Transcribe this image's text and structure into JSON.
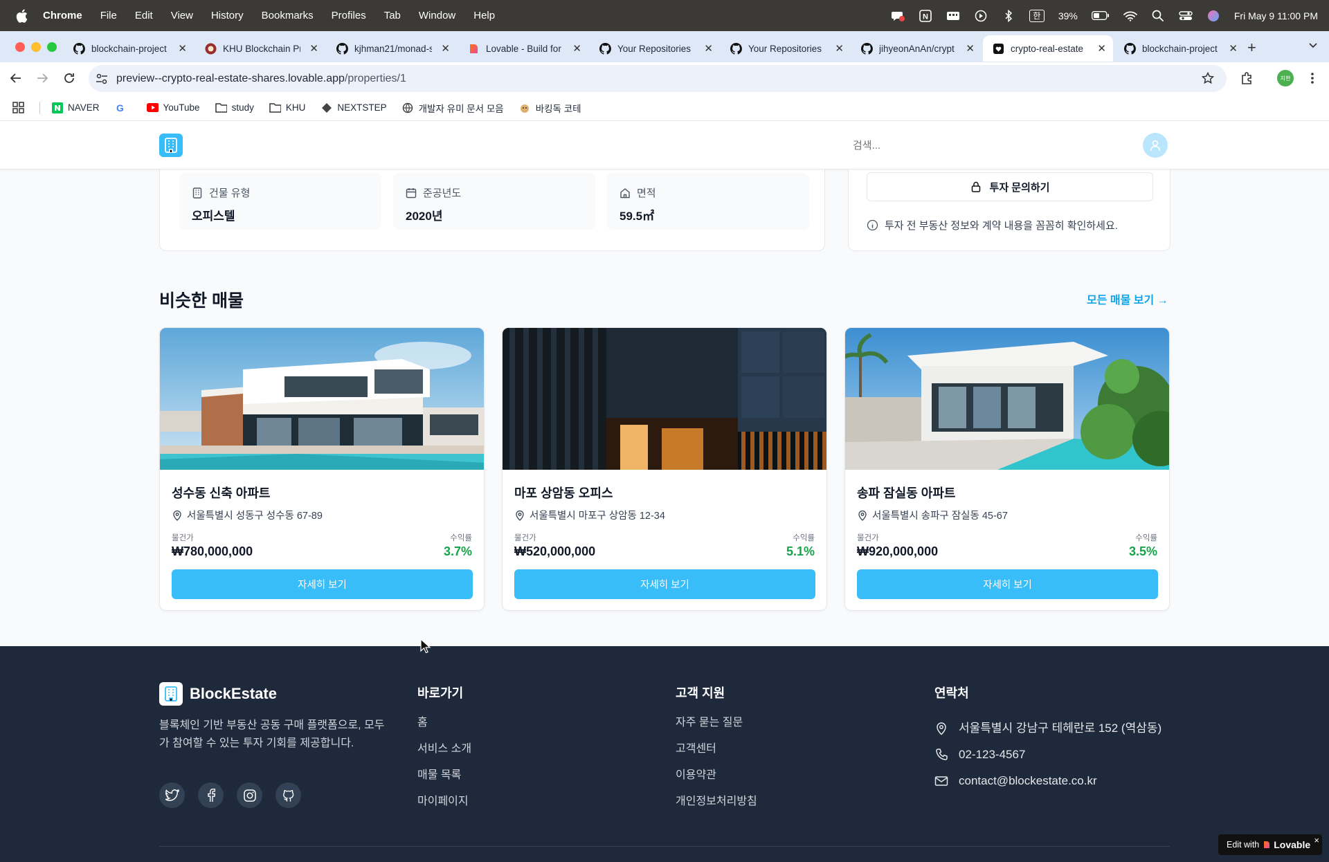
{
  "menubar": {
    "app": "Chrome",
    "items": [
      "File",
      "Edit",
      "View",
      "History",
      "Bookmarks",
      "Profiles",
      "Tab",
      "Window",
      "Help"
    ],
    "battery": "39%",
    "datetime": "Fri May 9  11:00 PM",
    "input_method": "한"
  },
  "tabs": [
    {
      "label": "blockchain-project",
      "icon": "github-icon"
    },
    {
      "label": "KHU Blockchain Pr",
      "icon": "khu-icon"
    },
    {
      "label": "kjhman21/monad-s",
      "icon": "github-icon"
    },
    {
      "label": "Lovable - Build for",
      "icon": "lovable-icon"
    },
    {
      "label": "Your Repositories",
      "icon": "github-icon"
    },
    {
      "label": "Your Repositories",
      "icon": "github-icon"
    },
    {
      "label": "jihyeonAnAn/crypt",
      "icon": "github-icon"
    },
    {
      "label": "crypto-real-estate",
      "icon": "lovable-heart-icon",
      "active": true
    },
    {
      "label": "blockchain-project",
      "icon": "github-icon"
    }
  ],
  "omnibox": {
    "host": "preview--crypto-real-estate-shares.lovable.app",
    "path": "/properties/1"
  },
  "bookmarks": [
    {
      "label": "NAVER",
      "icon": "naver-icon"
    },
    {
      "label": "",
      "icon": "google-icon"
    },
    {
      "label": "YouTube",
      "icon": "youtube-icon"
    },
    {
      "label": "study",
      "icon": "folder-icon"
    },
    {
      "label": "KHU",
      "icon": "folder-icon"
    },
    {
      "label": "NEXTSTEP",
      "icon": "nextstep-icon"
    },
    {
      "label": "개발자 유미 문서 모음",
      "icon": "globe-icon"
    },
    {
      "label": "바킹독 코테",
      "icon": "dog-icon"
    }
  ],
  "header": {
    "search_placeholder": "검색..."
  },
  "specs": [
    {
      "label": "건물 유형",
      "value": "오피스텔",
      "icon": "building-icon"
    },
    {
      "label": "준공년도",
      "value": "2020년",
      "icon": "calendar-icon"
    },
    {
      "label": "면적",
      "value": "59.5㎡",
      "icon": "home-icon"
    }
  ],
  "side": {
    "inquiry_button": "투자 문의하기",
    "notice": "투자 전 부동산 정보와 계약 내용을 꼼꼼히 확인하세요."
  },
  "similar": {
    "title": "비슷한 매물",
    "view_all": "모든 매물 보기 →",
    "price_label": "물건가",
    "yield_label": "수익률",
    "detail_button": "자세히 보기",
    "properties": [
      {
        "name": "성수동 신축 아파트",
        "address": "서울특별시 성동구 성수동 67-89",
        "price": "₩780,000,000",
        "yield": "3.7%"
      },
      {
        "name": "마포 상암동 오피스",
        "address": "서울특별시 마포구 상암동 12-34",
        "price": "₩520,000,000",
        "yield": "5.1%"
      },
      {
        "name": "송파 잠실동 아파트",
        "address": "서울특별시 송파구 잠실동 45-67",
        "price": "₩920,000,000",
        "yield": "3.5%"
      }
    ]
  },
  "footer": {
    "brand": "BlockEstate",
    "description": "블록체인 기반 부동산 공동 구매 플랫폼으로, 모두가 참여할 수 있는 투자 기회를 제공합니다.",
    "shortcuts_title": "바로가기",
    "shortcuts": [
      "홈",
      "서비스 소개",
      "매물 목록",
      "마이페이지"
    ],
    "support_title": "고객 지원",
    "support": [
      "자주 묻는 질문",
      "고객센터",
      "이용약관",
      "개인정보처리방침"
    ],
    "contact_title": "연락처",
    "contact": {
      "address": "서울특별시 강남구 테헤란로 152 (역삼동)",
      "phone": "02-123-4567",
      "email": "contact@blockestate.co.kr"
    }
  },
  "badge": {
    "prefix": "Edit with",
    "brand": "Lovable",
    "close": "×"
  },
  "colors": {
    "primary": "#38bdf8",
    "link": "#0ea5e9",
    "yield": "#16a34a",
    "footer_bg": "#1e293b"
  }
}
